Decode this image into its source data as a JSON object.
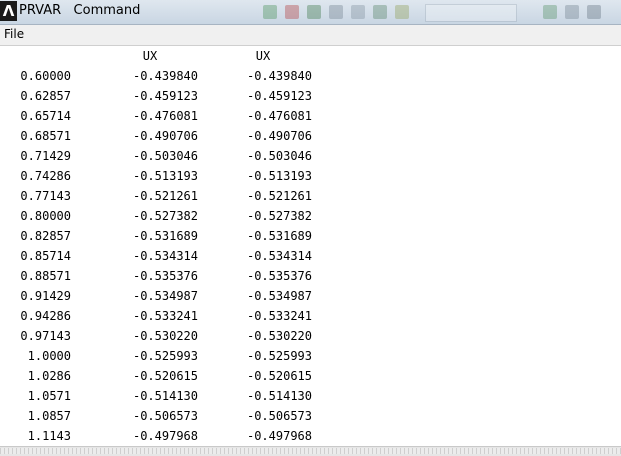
{
  "window": {
    "title": "PRVAR   Command"
  },
  "menu": {
    "file_label": "File"
  },
  "table": {
    "headers": [
      "UX",
      "UX"
    ],
    "rows": [
      [
        "0.60000",
        "-0.439840",
        "-0.439840"
      ],
      [
        "0.62857",
        "-0.459123",
        "-0.459123"
      ],
      [
        "0.65714",
        "-0.476081",
        "-0.476081"
      ],
      [
        "0.68571",
        "-0.490706",
        "-0.490706"
      ],
      [
        "0.71429",
        "-0.503046",
        "-0.503046"
      ],
      [
        "0.74286",
        "-0.513193",
        "-0.513193"
      ],
      [
        "0.77143",
        "-0.521261",
        "-0.521261"
      ],
      [
        "0.80000",
        "-0.527382",
        "-0.527382"
      ],
      [
        "0.82857",
        "-0.531689",
        "-0.531689"
      ],
      [
        "0.85714",
        "-0.534314",
        "-0.534314"
      ],
      [
        "0.88571",
        "-0.535376",
        "-0.535376"
      ],
      [
        "0.91429",
        "-0.534987",
        "-0.534987"
      ],
      [
        "0.94286",
        "-0.533241",
        "-0.533241"
      ],
      [
        "0.97143",
        "-0.530220",
        "-0.530220"
      ],
      [
        "1.0000",
        "-0.525993",
        "-0.525993"
      ],
      [
        "1.0286",
        "-0.520615",
        "-0.520615"
      ],
      [
        "1.0571",
        "-0.514130",
        "-0.514130"
      ],
      [
        "1.0857",
        "-0.506573",
        "-0.506573"
      ],
      [
        "1.1143",
        "-0.497968",
        "-0.497968"
      ]
    ]
  },
  "icons": {
    "app": "ansys-logo-icon"
  }
}
